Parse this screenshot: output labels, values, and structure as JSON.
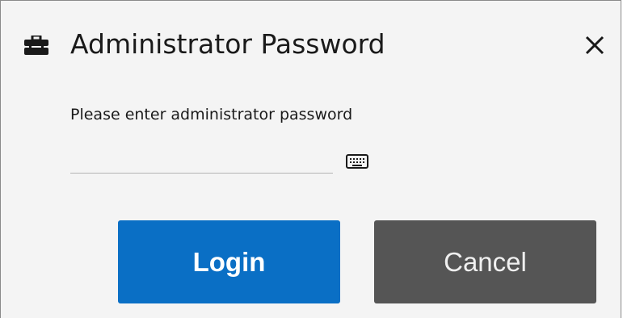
{
  "dialog": {
    "title": "Administrator Password",
    "title_icon": "toolbox-icon",
    "close_icon": "close-icon"
  },
  "form": {
    "prompt": "Please enter administrator password",
    "password_value": "",
    "keyboard_icon": "keyboard-icon"
  },
  "buttons": {
    "login_label": "Login",
    "cancel_label": "Cancel"
  },
  "colors": {
    "login_bg": "#0a6fc5",
    "cancel_bg": "#555555",
    "dialog_bg": "#f4f4f4"
  }
}
